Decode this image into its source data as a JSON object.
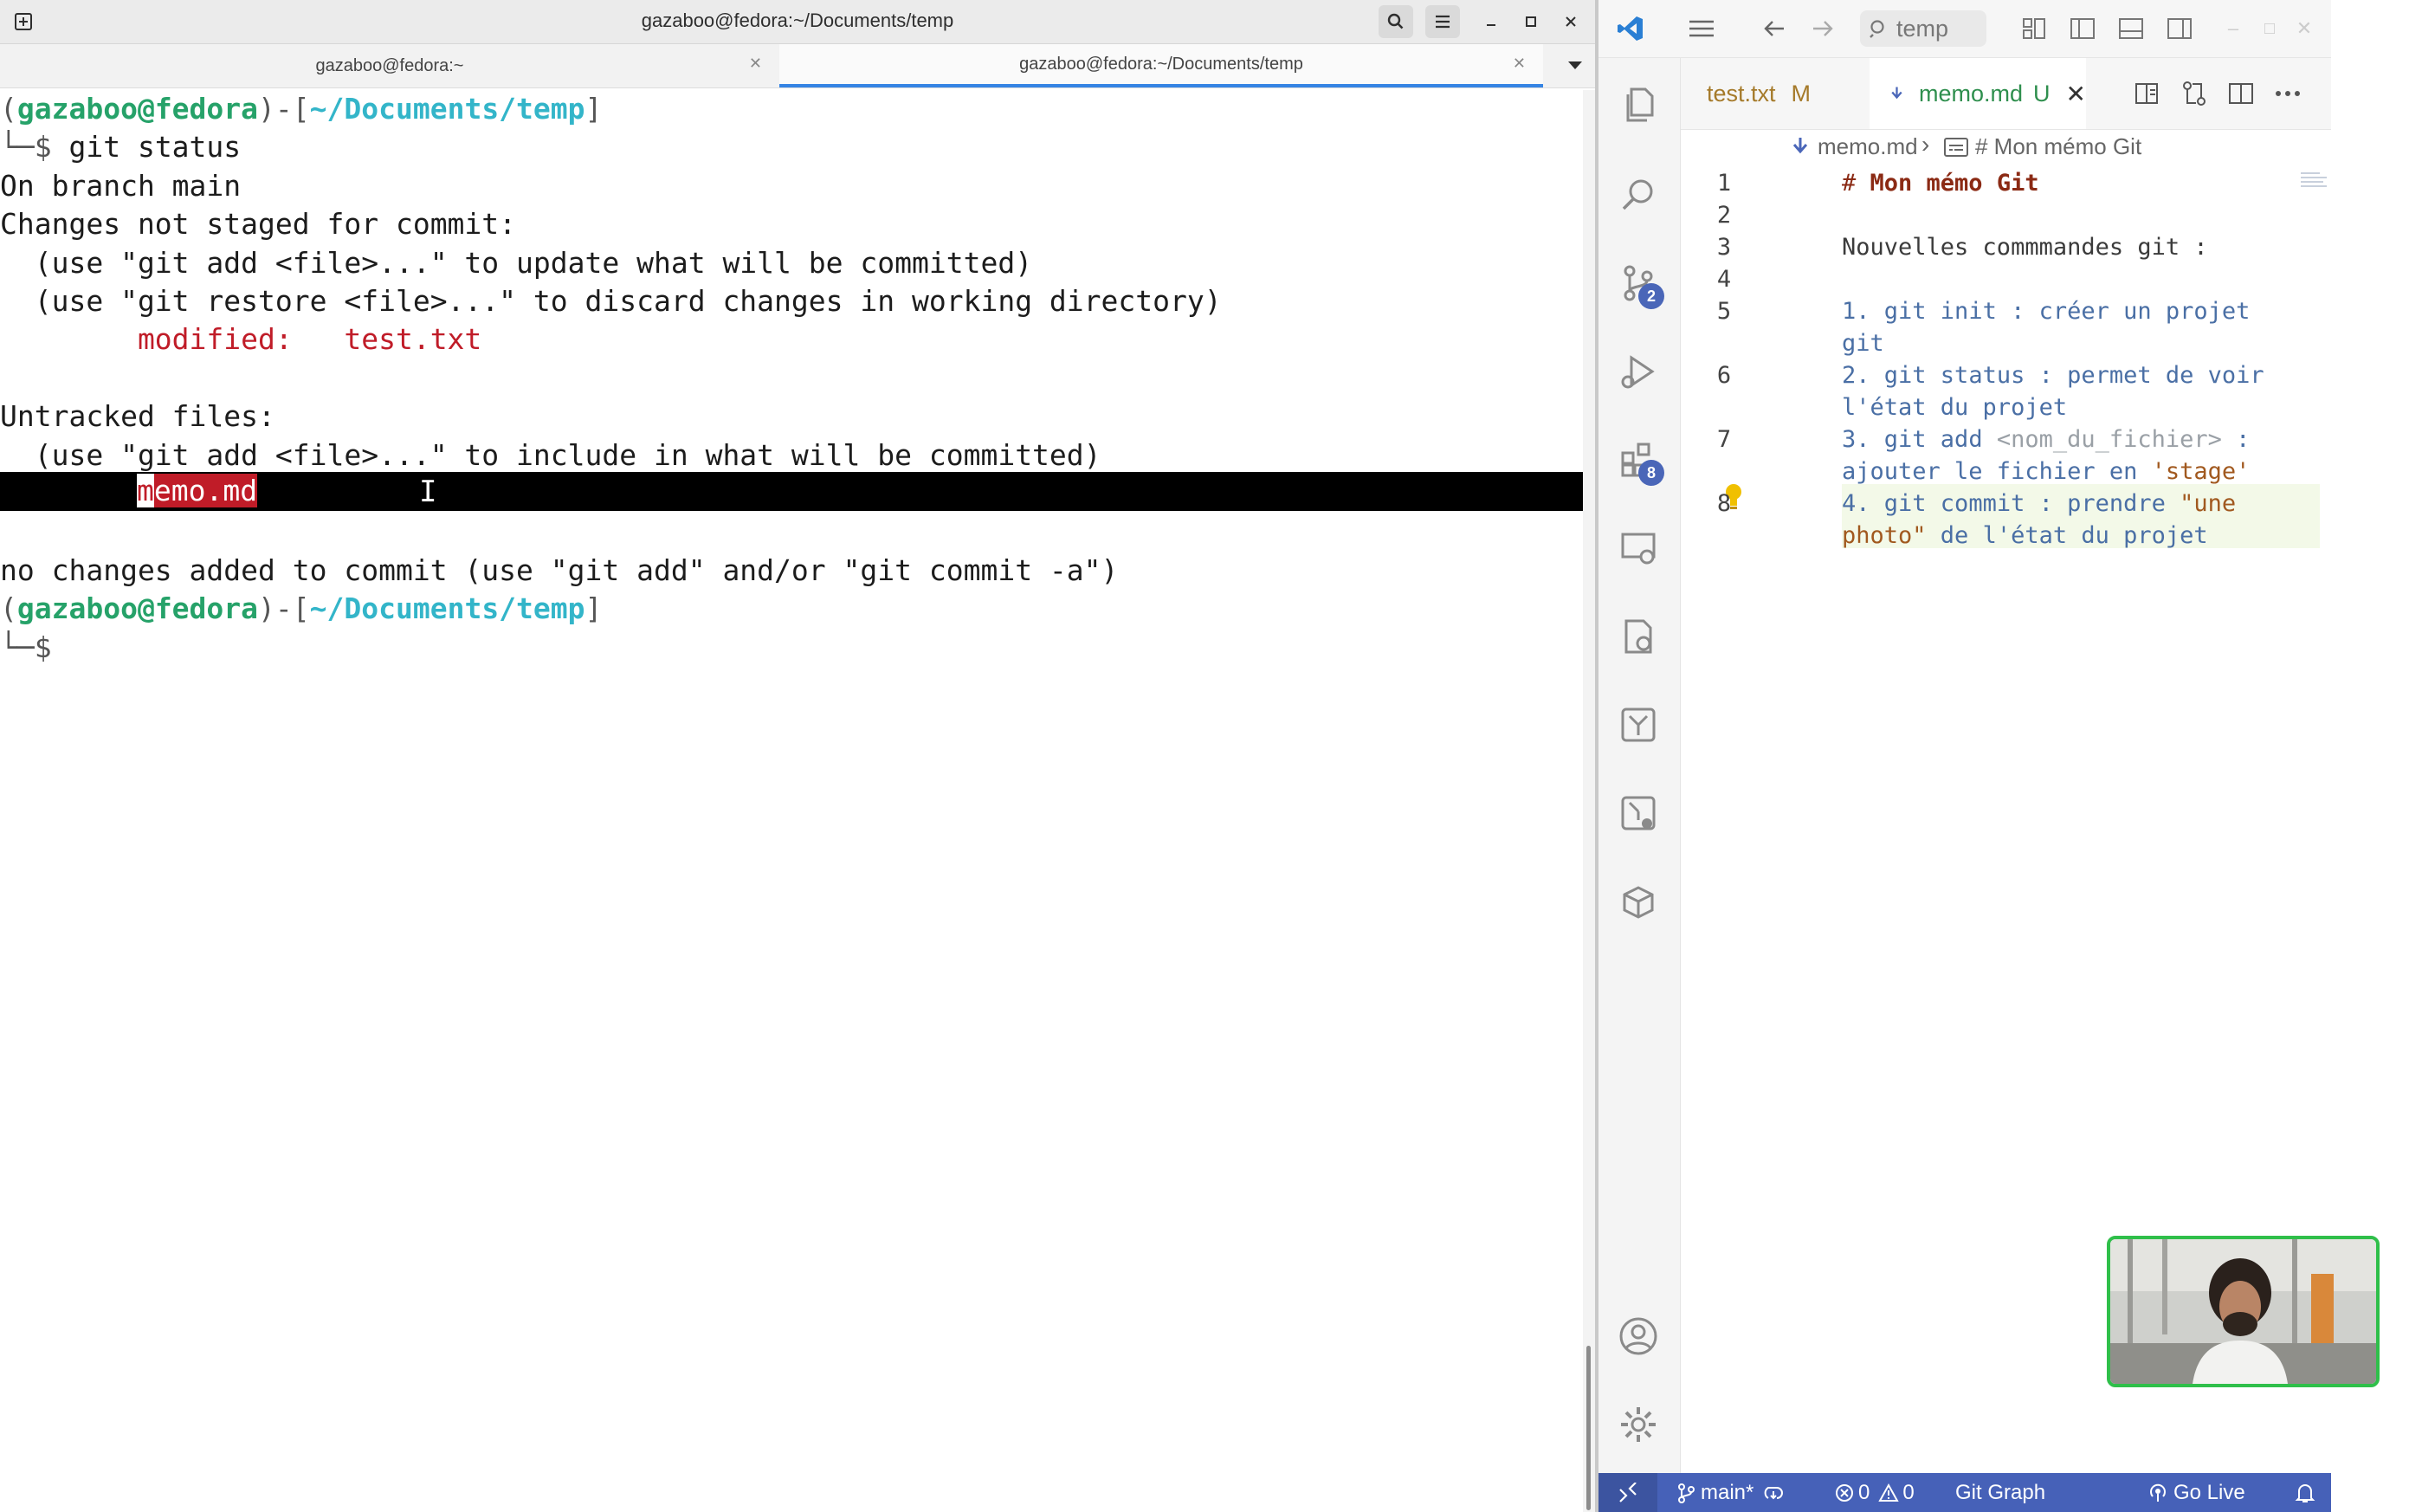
{
  "terminal": {
    "window_title": "gazaboo@fedora:~/Documents/temp",
    "tabs": [
      {
        "label": "gazaboo@fedora:~"
      },
      {
        "label": "gazaboo@fedora:~/Documents/temp"
      }
    ],
    "prompt": {
      "user_host": "gazaboo@fedora",
      "path": "~/Documents/temp",
      "open": "(",
      "close": ")-[",
      "end": "]",
      "dollar": "└─$"
    },
    "command": " git status",
    "output": {
      "branch": "On branch main",
      "not_staged": "Changes not staged for commit:",
      "hint_add": "  (use \"git add <file>...\" to update what will be committed)",
      "hint_restore": "  (use \"git restore <file>...\" to discard changes in working directory)",
      "modified_label": "        modified:   test.txt",
      "untracked": "Untracked files:",
      "hint_include": "  (use \"git add <file>...\" to include in what will be committed)",
      "untracked_file_first": "m",
      "untracked_file_rest": "emo.md",
      "no_changes": "no changes added to commit (use \"git add\" and/or \"git commit -a\")"
    }
  },
  "vscode": {
    "search_label": "temp",
    "tabs": [
      {
        "label": "test.txt",
        "status": "M"
      },
      {
        "label": "memo.md",
        "status": "U"
      }
    ],
    "breadcrumb": {
      "file": "memo.md",
      "symbol": "# Mon mémo Git"
    },
    "lines": [
      {
        "n": "1",
        "hash": "# ",
        "text": "Mon mémo Git"
      },
      {
        "n": "2",
        "text": ""
      },
      {
        "n": "3",
        "text": "Nouvelles commmandes git :"
      },
      {
        "n": "4",
        "text": ""
      },
      {
        "n": "5",
        "a": "1. ",
        "b": "git init : créer un projet",
        "c": "git"
      },
      {
        "n": "6",
        "a": "2. ",
        "b": "git status : permet de voir",
        "c": "l'état du projet"
      },
      {
        "n": "7",
        "a": "3. ",
        "b": "git add ",
        "tag": "<nom_du_fichier>",
        "b2": " :",
        "c": "ajouter le fichier en ",
        "str": "'stage'"
      },
      {
        "n": "8",
        "a": "4. ",
        "b": "git commit : prendre ",
        "str": "\"une",
        "c_str": "photo\"",
        "c": " de l'état du projet"
      }
    ],
    "badges": {
      "source_control": "2",
      "extensions": "8"
    },
    "status_bar": {
      "branch": "main*",
      "errors": "0",
      "warnings": "0",
      "git_graph": "Git Graph",
      "go_live": "Go Live"
    }
  },
  "colors": {
    "terminal_green": "#26a269",
    "terminal_blue": "#33b5c9",
    "highlight_red": "#c01c28",
    "status_bar": "#4661b8"
  }
}
